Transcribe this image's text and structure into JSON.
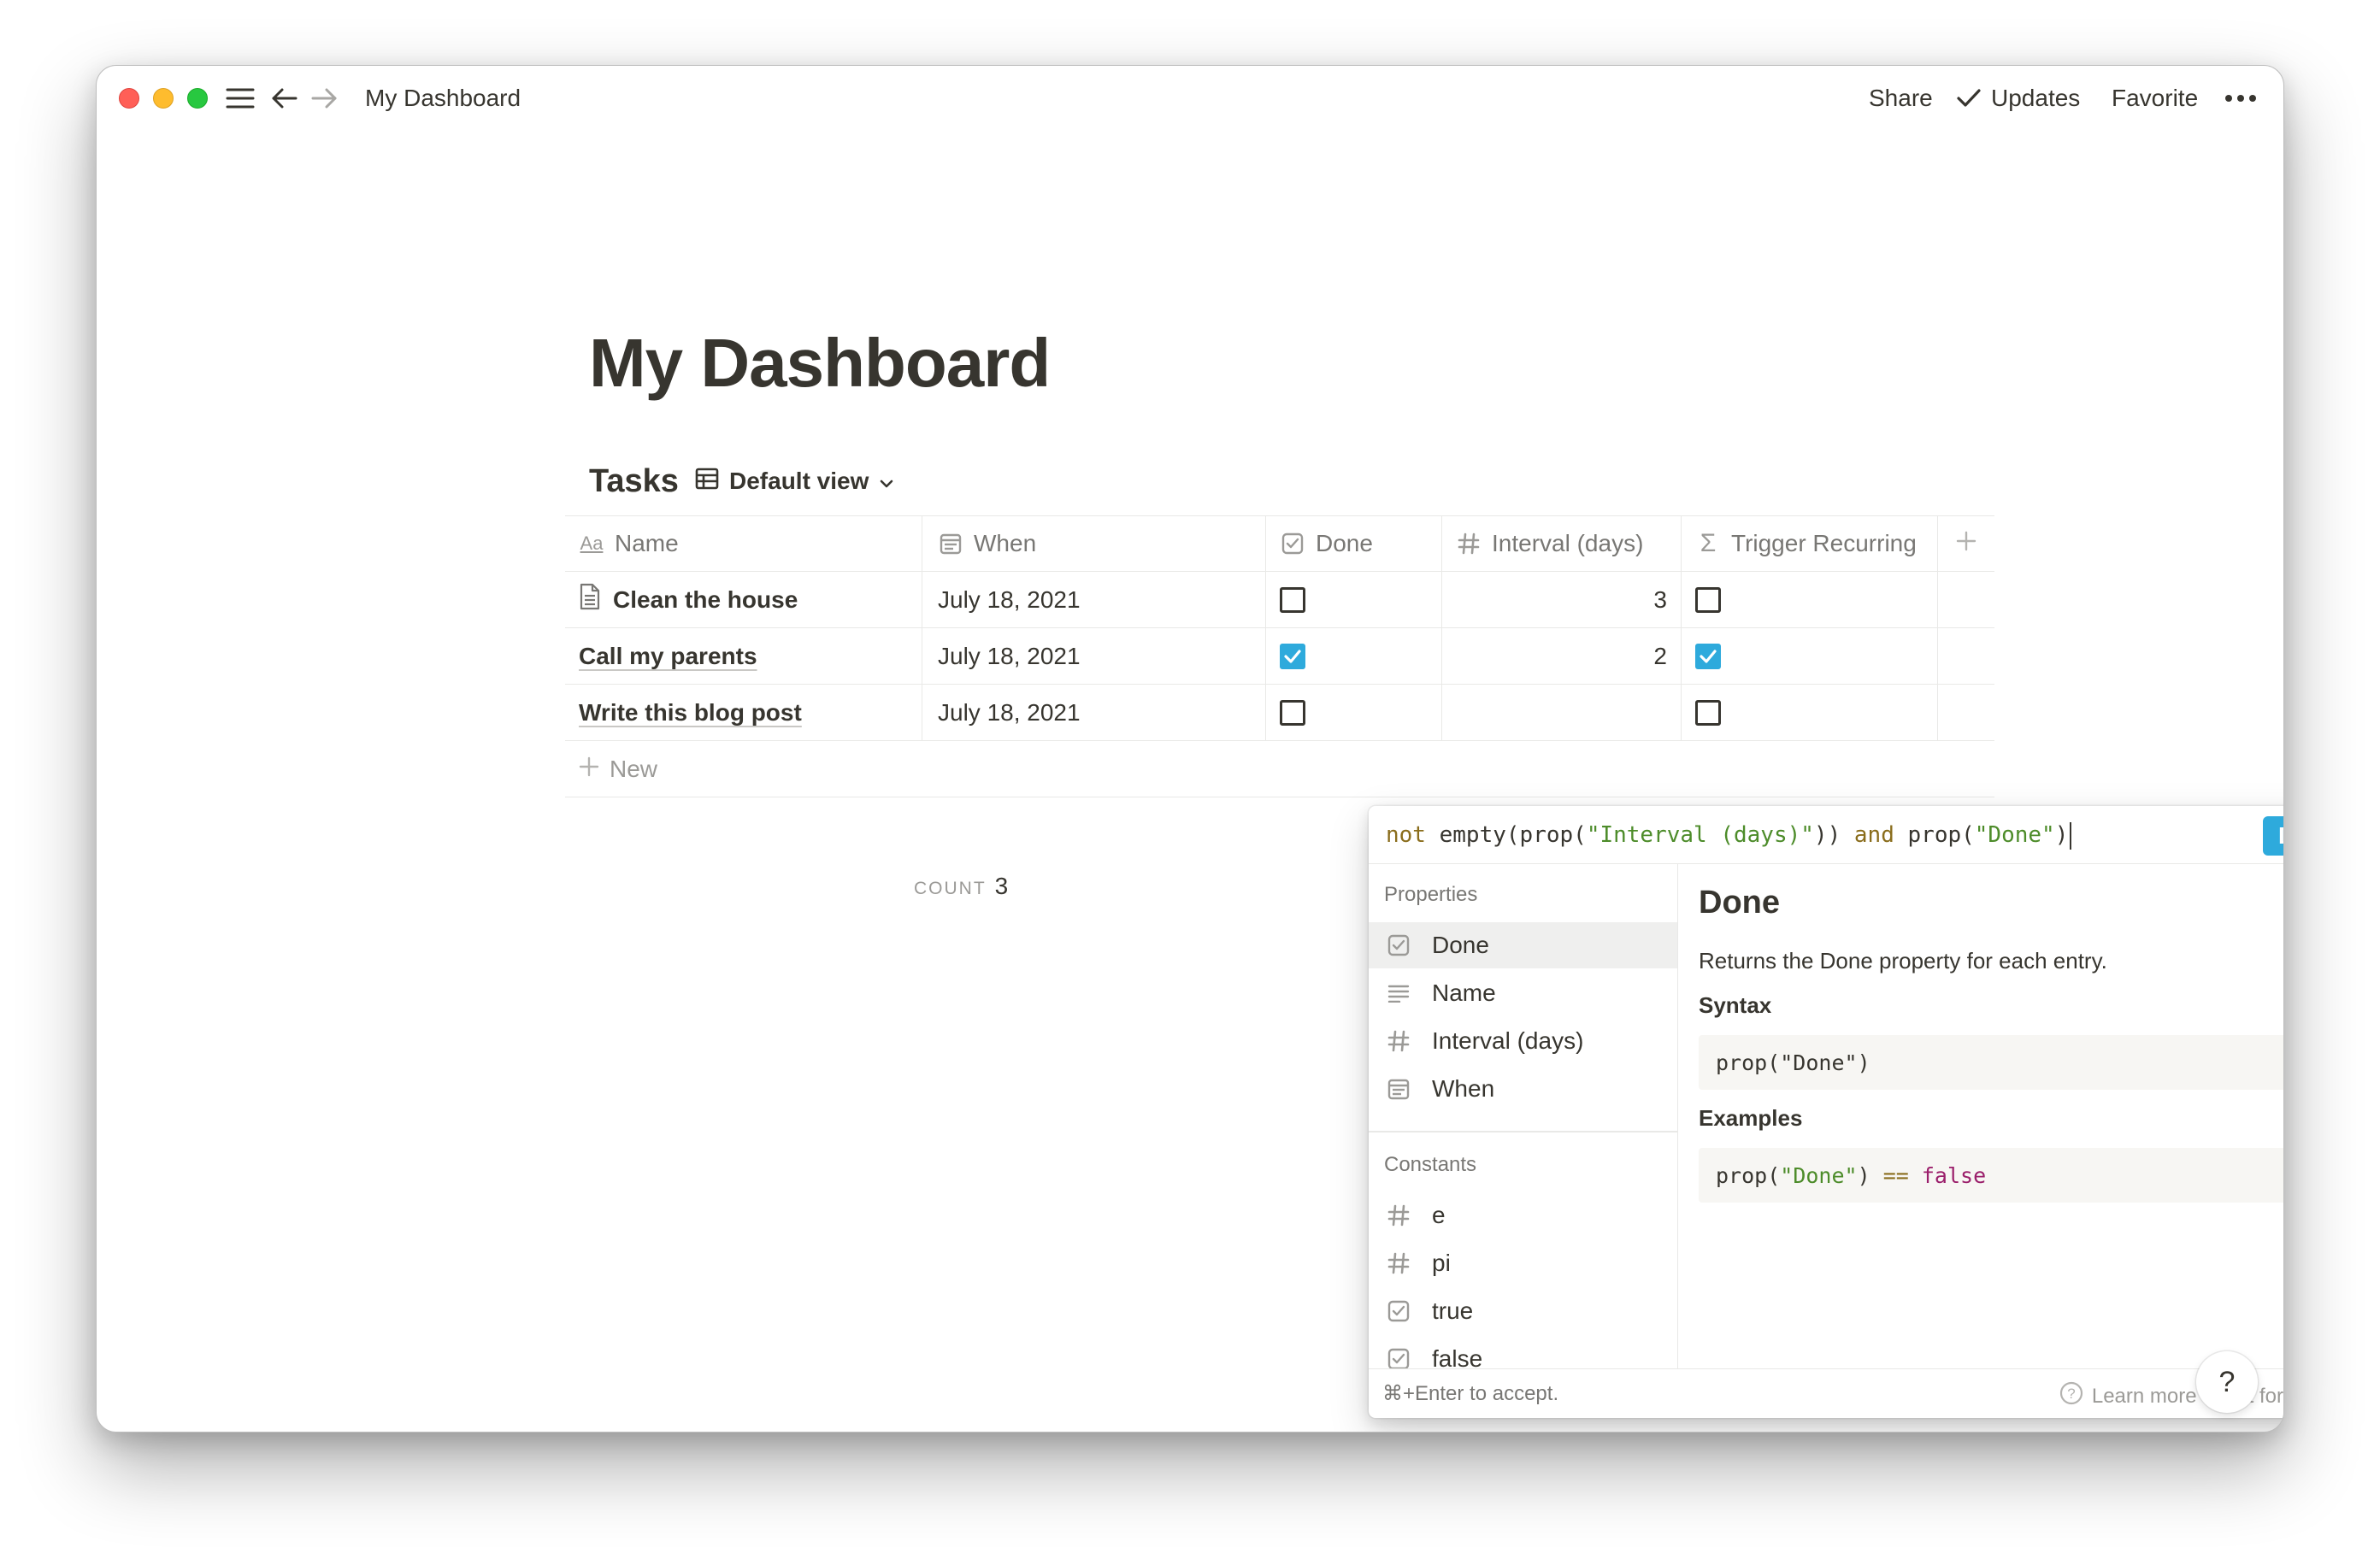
{
  "window": {
    "breadcrumb": "My Dashboard",
    "actions": {
      "share": "Share",
      "updates": "Updates",
      "favorite": "Favorite"
    }
  },
  "page": {
    "title": "My Dashboard"
  },
  "database": {
    "title": "Tasks",
    "view_label": "Default view",
    "columns": [
      {
        "label": "Name",
        "icon": "text-aa-icon"
      },
      {
        "label": "When",
        "icon": "calendar-icon"
      },
      {
        "label": "Done",
        "icon": "checkbox-icon"
      },
      {
        "label": "Interval (days)",
        "icon": "hash-icon"
      },
      {
        "label": "Trigger Recurring",
        "icon": "sigma-icon"
      }
    ],
    "rows": [
      {
        "name": "Clean the house",
        "when": "July 18, 2021",
        "done": false,
        "interval": "3",
        "trigger": false
      },
      {
        "name": "Call my parents",
        "when": "July 18, 2021",
        "done": true,
        "interval": "2",
        "trigger": true
      },
      {
        "name": "Write this blog post",
        "when": "July 18, 2021",
        "done": false,
        "interval": "",
        "trigger": false
      }
    ],
    "new_label": "New",
    "count_label": "COUNT",
    "count_value": "3"
  },
  "formula_editor": {
    "done_button": "Done",
    "properties_label": "Properties",
    "properties": [
      "Done",
      "Name",
      "Interval (days)",
      "When"
    ],
    "constants_label": "Constants",
    "constants": [
      "e",
      "pi",
      "true",
      "false"
    ],
    "detail": {
      "title": "Done",
      "description": "Returns the Done property for each entry.",
      "syntax_label": "Syntax",
      "syntax": "prop(\"Done\")",
      "examples_label": "Examples"
    },
    "footer_hint": "⌘+Enter to accept.",
    "footer_link": "Learn more about formulas"
  },
  "help_label": "?",
  "colors": {
    "accent": "#2eaadc",
    "text": "#37352f",
    "muted": "#9b9a97"
  }
}
